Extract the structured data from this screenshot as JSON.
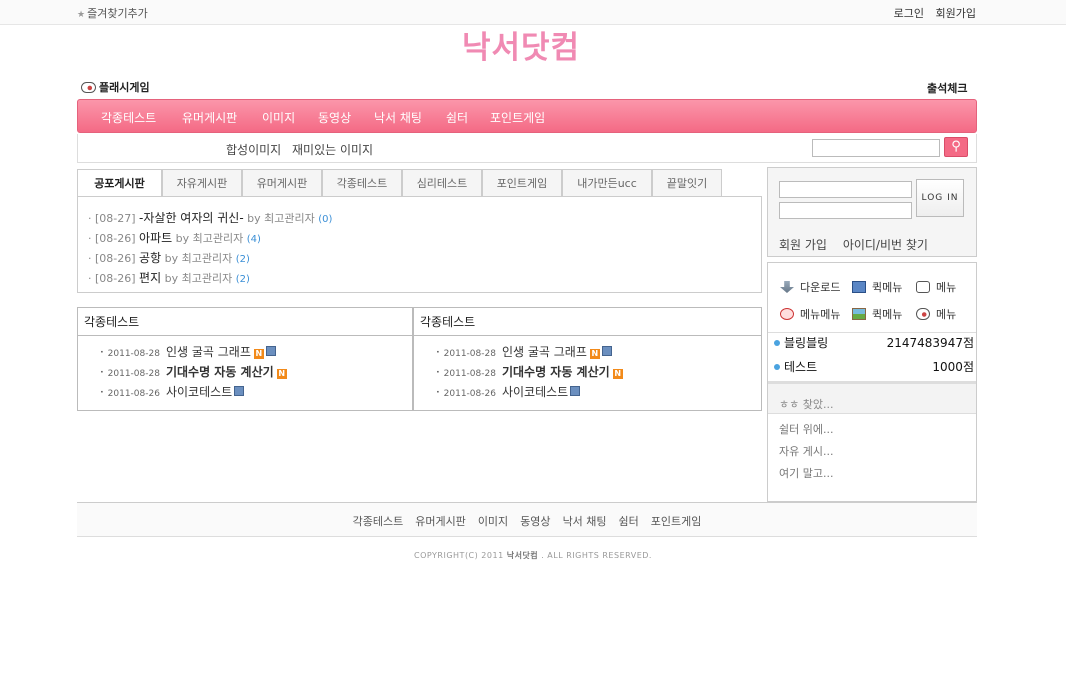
{
  "topbar": {
    "favorite": "즐겨찾기추가",
    "login": "로그인",
    "join": "회원가입"
  },
  "logo": "낙서닷컴",
  "flash_game": "플래시게임",
  "attendance": "출석체크",
  "nav": {
    "items": [
      "각종테스트",
      "유머게시판",
      "이미지",
      "동영상",
      "낙서 채팅",
      "쉼터",
      "포인트게임"
    ]
  },
  "subnav": {
    "items": [
      "합성이미지",
      "재미있는 이미지"
    ]
  },
  "search": {
    "button": "⚲"
  },
  "tabs": [
    "공포게시판",
    "자유게시판",
    "유머게시판",
    "각종테스트",
    "심리테스트",
    "포인트게임",
    "내가만든ucc",
    "끝말잇기"
  ],
  "tab_posts": [
    {
      "date": "[08-27]",
      "title": "-자살한 여자의 귀신-",
      "by": "by",
      "author": "최고관리자",
      "count": "(0)"
    },
    {
      "date": "[08-26]",
      "title": "아파트",
      "by": "by",
      "author": "최고관리자",
      "count": "(4)"
    },
    {
      "date": "[08-26]",
      "title": "공항",
      "by": "by",
      "author": "최고관리자",
      "count": "(2)"
    },
    {
      "date": "[08-26]",
      "title": "편지",
      "by": "by",
      "author": "최고관리자",
      "count": "(2)"
    }
  ],
  "boards": [
    {
      "title": "각종테스트",
      "rows": [
        {
          "date": "2011-08-28",
          "title": "인생 굴곡 그래프"
        },
        {
          "date": "2011-08-28",
          "title": "기대수명 자동 계산기"
        },
        {
          "date": "2011-08-26",
          "title": "사이코테스트"
        }
      ]
    },
    {
      "title": "각종테스트",
      "rows": [
        {
          "date": "2011-08-28",
          "title": "인생 굴곡 그래프"
        },
        {
          "date": "2011-08-28",
          "title": "기대수명 자동 계산기"
        },
        {
          "date": "2011-08-26",
          "title": "사이코테스트"
        }
      ]
    }
  ],
  "login_box": {
    "button": "LOG IN",
    "join": "회원 가입",
    "find": "아이디/비번 찾기"
  },
  "quick_menu": [
    "다운로드",
    "퀵메뉴",
    "메뉴",
    "메뉴메뉴",
    "퀵메뉴",
    "메뉴"
  ],
  "ranking": [
    {
      "name": "블링블링",
      "points": "2147483947점"
    },
    {
      "name": "테스트",
      "points": "1000점"
    }
  ],
  "info": {
    "head": "ㅎㅎ 찾았...",
    "items": [
      "쉴터 위에...",
      "자유 게시...",
      "여기 말고..."
    ]
  },
  "footer": {
    "nav": [
      "각종테스트",
      "유머게시판",
      "이미지",
      "동영상",
      "낙서 채팅",
      "쉼터",
      "포인트게임"
    ],
    "copyright": "COPYRIGHT(C) 2011",
    "brand": "낙서닷컴",
    "rights": ". ALL RIGHTS RESERVED."
  }
}
